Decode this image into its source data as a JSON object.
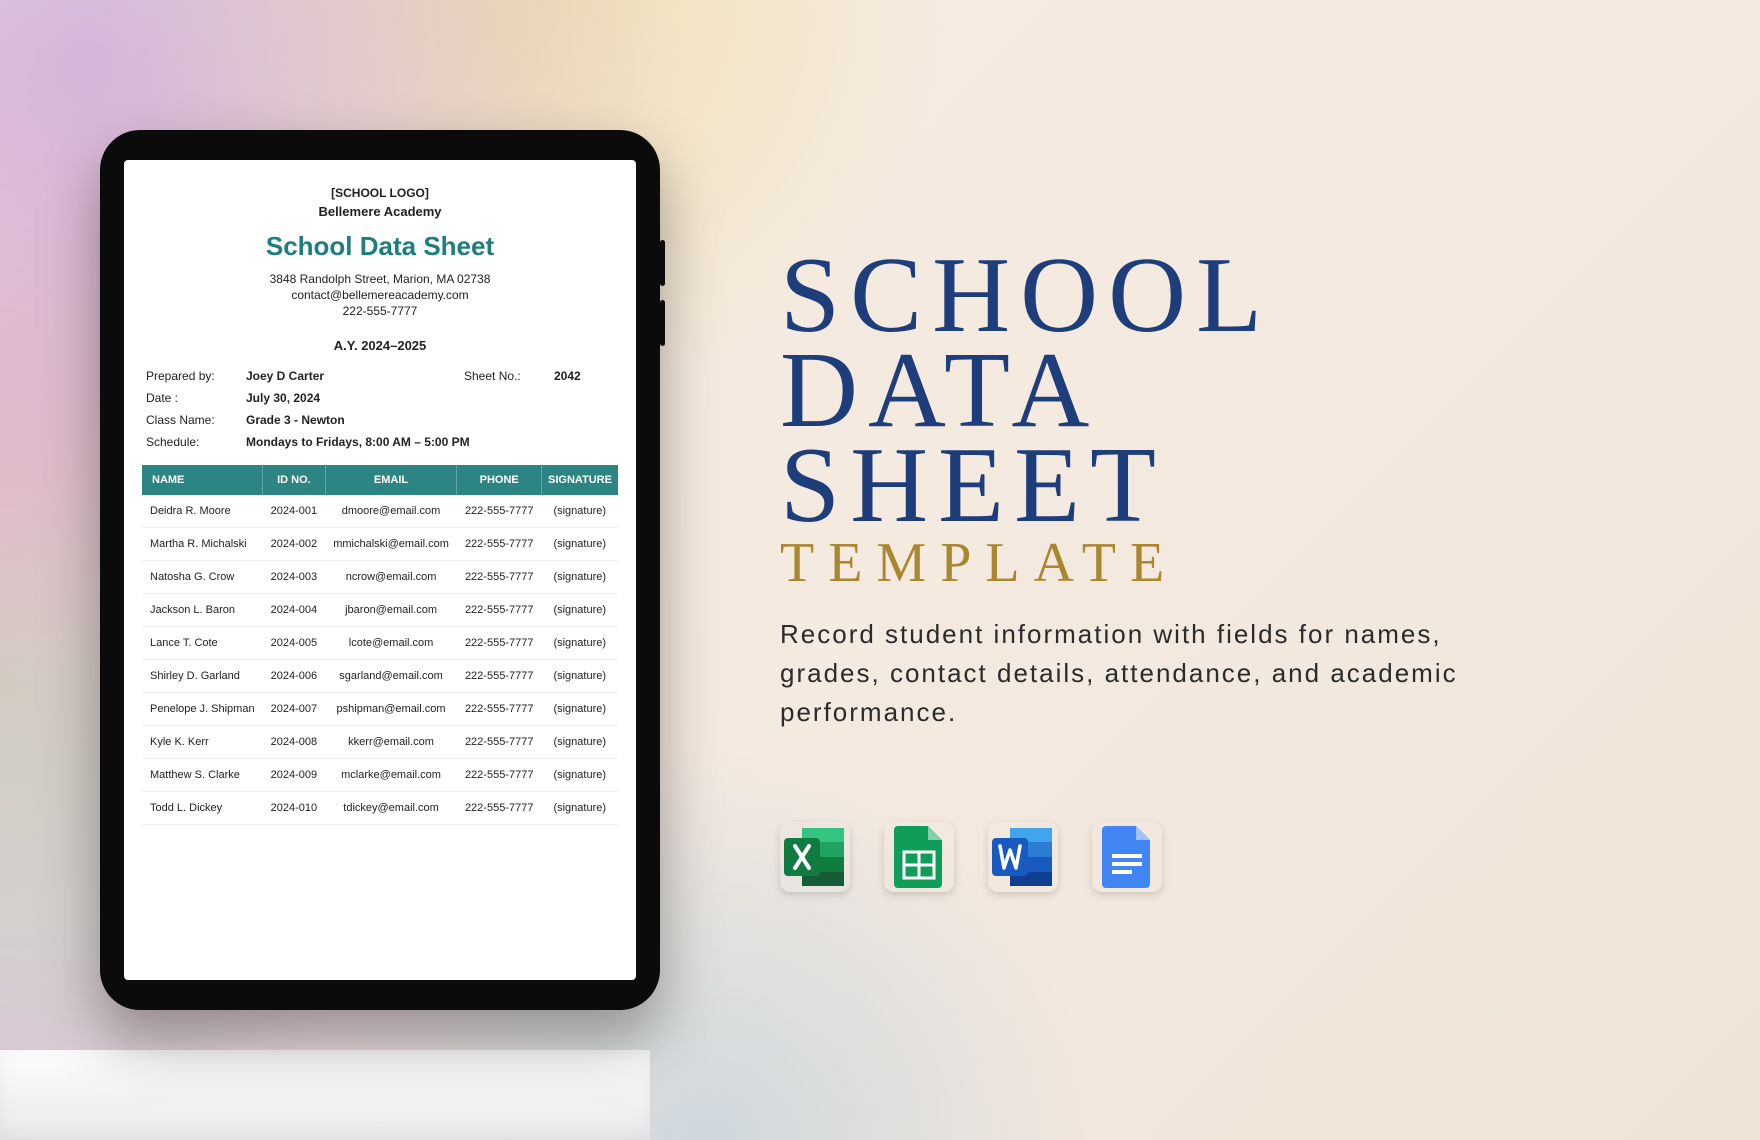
{
  "doc": {
    "logo_placeholder": "[SCHOOL LOGO]",
    "school_name": "Bellemere Academy",
    "title": "School Data Sheet",
    "address": "3848 Randolph Street, Marion, MA 02738",
    "email": "contact@bellemereacademy.com",
    "phone": "222-555-7777",
    "academic_year": "A.Y. 2024–2025",
    "meta": {
      "prepared_by_label": "Prepared by:",
      "prepared_by": "Joey D Carter",
      "sheet_no_label": "Sheet No.:",
      "sheet_no": "2042",
      "date_label": "Date :",
      "date": "July 30, 2024",
      "class_label": "Class Name:",
      "class": "Grade 3 - Newton",
      "schedule_label": "Schedule:",
      "schedule": "Mondays to Fridays, 8:00 AM – 5:00 PM"
    },
    "table": {
      "headers": {
        "name": "NAME",
        "id": "ID NO.",
        "email": "EMAIL",
        "phone": "PHONE",
        "sig": "SIGNATURE"
      },
      "rows": [
        {
          "name": "Deidra R. Moore",
          "id": "2024-001",
          "email": "dmoore@email.com",
          "phone": "222-555-7777",
          "sig": "(signature)"
        },
        {
          "name": "Martha R. Michalski",
          "id": "2024-002",
          "email": "mmichalski@email.com",
          "phone": "222-555-7777",
          "sig": "(signature)"
        },
        {
          "name": "Natosha G. Crow",
          "id": "2024-003",
          "email": "ncrow@email.com",
          "phone": "222-555-7777",
          "sig": "(signature)"
        },
        {
          "name": "Jackson L. Baron",
          "id": "2024-004",
          "email": "jbaron@email.com",
          "phone": "222-555-7777",
          "sig": "(signature)"
        },
        {
          "name": "Lance T. Cote",
          "id": "2024-005",
          "email": "lcote@email.com",
          "phone": "222-555-7777",
          "sig": "(signature)"
        },
        {
          "name": "Shirley D. Garland",
          "id": "2024-006",
          "email": "sgarland@email.com",
          "phone": "222-555-7777",
          "sig": "(signature)"
        },
        {
          "name": "Penelope J. Shipman",
          "id": "2024-007",
          "email": "pshipman@email.com",
          "phone": "222-555-7777",
          "sig": "(signature)"
        },
        {
          "name": "Kyle K. Kerr",
          "id": "2024-008",
          "email": "kkerr@email.com",
          "phone": "222-555-7777",
          "sig": "(signature)"
        },
        {
          "name": "Matthew S. Clarke",
          "id": "2024-009",
          "email": "mclarke@email.com",
          "phone": "222-555-7777",
          "sig": "(signature)"
        },
        {
          "name": "Todd L. Dickey",
          "id": "2024-010",
          "email": "tdickey@email.com",
          "phone": "222-555-7777",
          "sig": "(signature)"
        }
      ]
    }
  },
  "promo": {
    "line1": "SCHOOL",
    "line2": "DATA",
    "line3": "SHEET",
    "line4": "TEMPLATE",
    "description": "Record student information with fields for names, grades, contact details, attendance, and academic performance."
  },
  "apps": {
    "excel": {
      "name": "excel-icon",
      "base": "#107c41",
      "light": "#21a366"
    },
    "sheets": {
      "name": "sheets-icon",
      "base": "#0f9d58",
      "light": "#34a853"
    },
    "word": {
      "name": "word-icon",
      "base": "#185abd",
      "light": "#2b7cd3"
    },
    "docs": {
      "name": "docs-icon",
      "base": "#4285f4",
      "light": "#669df6"
    }
  }
}
